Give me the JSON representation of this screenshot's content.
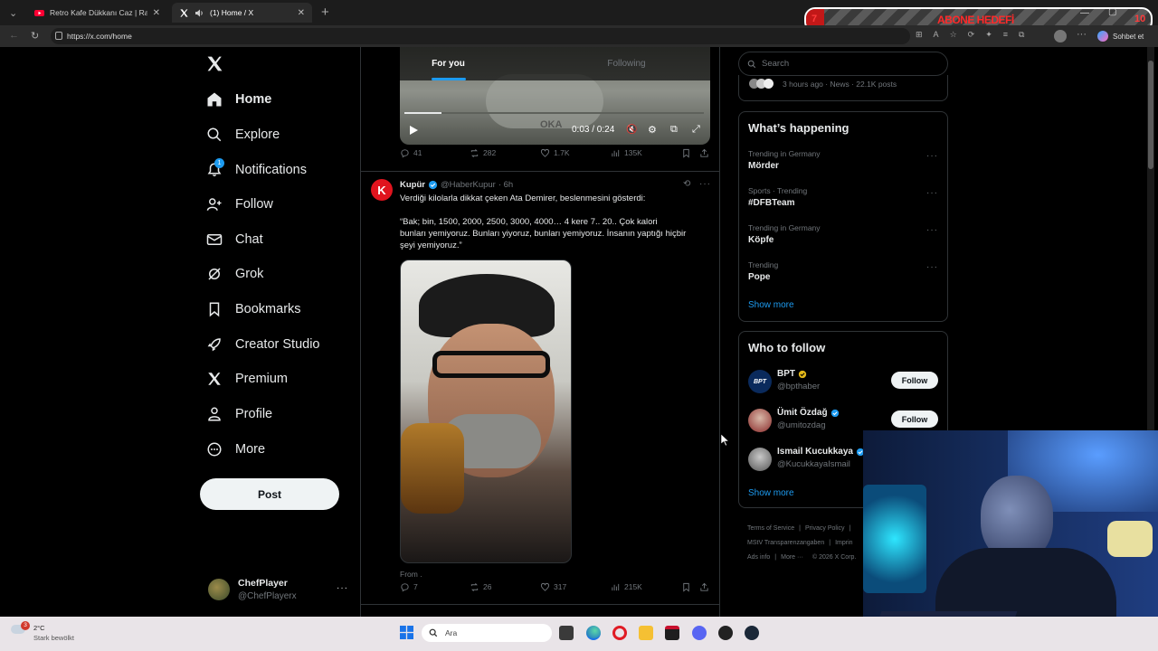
{
  "browser": {
    "tabs": [
      {
        "title": "Retro Kafe Dükkanı Caz | Rahat Bi"
      },
      {
        "title": "(1) Home / X"
      }
    ],
    "url": "https://x.com/home",
    "overlay_banner": "ABONE HEDEFİ",
    "overlay_left_num": "7",
    "overlay_right_num": "10",
    "sohbet": "Sohbet et"
  },
  "nav": {
    "items": [
      {
        "label": "Home",
        "icon": "home-icon"
      },
      {
        "label": "Explore",
        "icon": "search-icon"
      },
      {
        "label": "Notifications",
        "icon": "bell-icon",
        "badge": "1"
      },
      {
        "label": "Follow",
        "icon": "person-add-icon"
      },
      {
        "label": "Chat",
        "icon": "mail-icon"
      },
      {
        "label": "Grok",
        "icon": "grok-icon"
      },
      {
        "label": "Bookmarks",
        "icon": "bookmark-icon"
      },
      {
        "label": "Creator Studio",
        "icon": "rocket-icon"
      },
      {
        "label": "Premium",
        "icon": "x-logo-icon"
      },
      {
        "label": "Profile",
        "icon": "person-icon"
      },
      {
        "label": "More",
        "icon": "more-circle-icon"
      }
    ],
    "post_label": "Post",
    "account": {
      "name": "ChefPlayer",
      "handle": "@ChefPlayerx"
    }
  },
  "feed": {
    "tabs": [
      "For you",
      "Following"
    ],
    "video": {
      "time": "0:03 / 0:24",
      "progress": 0.125,
      "watermark": "OKA"
    },
    "post1_actions": {
      "replies": "41",
      "reposts": "282",
      "likes": "1.7K",
      "views": "135K"
    },
    "post2": {
      "name": "Kupür",
      "handle": "@HaberKupur",
      "time": "· 6h",
      "avatar_letter": "K",
      "line1": "Verdiği kilolarla dikkat çeken Ata Demirer, beslenmesini gösterdi:",
      "quote_line1": "“Bak; bin, 1500, 2000, 2500, 3000, 4000… 4 kere 7.. 20.. Çok kalori",
      "quote_line2": "bunları yemiyoruz. Bunları yiyoruz, bunları yemiyoruz. İnsanın yaptığı hiçbir",
      "quote_line3": "şeyi yemiyoruz.”",
      "caption": "From .",
      "actions": {
        "replies": "7",
        "reposts": "26",
        "likes": "317",
        "views": "215K"
      }
    }
  },
  "right": {
    "search_placeholder": "Search",
    "news_meta": "3 hours ago · News · 22.1K posts",
    "whats_happening": "What’s happening",
    "trends": [
      {
        "meta": "Trending in Germany",
        "title": "Mörder"
      },
      {
        "meta": "Sports · Trending",
        "title": "#DFBTeam"
      },
      {
        "meta": "Trending in Germany",
        "title": "Köpfe"
      },
      {
        "meta": "Trending",
        "title": "Pope"
      }
    ],
    "show_more": "Show more",
    "who_to_follow": "Who to follow",
    "follow_suggestions": [
      {
        "name": "BPT",
        "handle": "@bpthaber",
        "avatar_text": "BPT"
      },
      {
        "name": "Ümit Özdağ",
        "handle": "@umitozdag"
      },
      {
        "name": "Ismail Kucukkaya",
        "handle": "@KucukkayaIsmail"
      }
    ],
    "follow_label": "Follow",
    "footer_line1": [
      "Terms of Service",
      "Privacy Policy"
    ],
    "footer_line2": "MStV Transparenzangaben",
    "footer_line2b": "Imprin",
    "footer_line3": [
      "Ads info",
      "More ···",
      "© 2026 X Corp."
    ]
  },
  "taskbar": {
    "temp": "2°C",
    "weather": "Stark bewölkt",
    "weather_badge": "3",
    "search": "Ara"
  }
}
